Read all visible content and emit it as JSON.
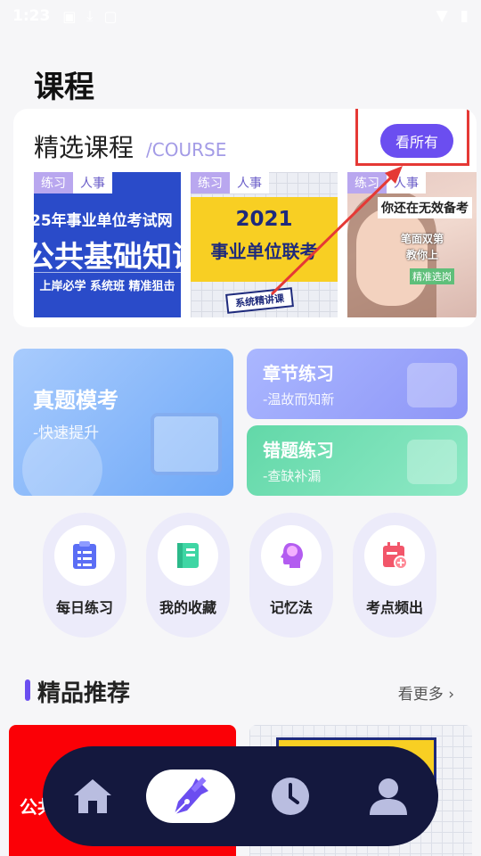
{
  "status_bar": {
    "time": "1:23",
    "icons": [
      "image-icon",
      "download-icon",
      "android-icon",
      "wifi-icon",
      "battery-icon"
    ]
  },
  "page": {
    "title": "课程"
  },
  "courses": {
    "title": "精选课程",
    "subtitle": "/COURSE",
    "see_all": "看所有",
    "items": [
      {
        "tags": [
          "练习",
          "人事"
        ],
        "line1": "25年事业单位考试网",
        "line2": "公共基础知识",
        "line3": "上岸必学 系统班 精准狙击"
      },
      {
        "tags": [
          "练习",
          "人事"
        ],
        "year": "2021",
        "title": "事业单位联考",
        "badge": "系统精讲课"
      },
      {
        "tags": [
          "练习",
          "人事"
        ],
        "cap1": "你还在无效备考",
        "cap2": "笔面双第",
        "cap3": "教你上",
        "cap4": "精准选岗"
      }
    ]
  },
  "tiles": {
    "exam": {
      "title": "真题模考",
      "sub": "-快速提升"
    },
    "chapter": {
      "title": "章节练习",
      "sub": "-温故而知新"
    },
    "wrong": {
      "title": "错题练习",
      "sub": "-查缺补漏"
    }
  },
  "quick_actions": [
    {
      "label": "每日练习",
      "icon": "clipboard-list-icon",
      "color": "#5b6ef5"
    },
    {
      "label": "我的收藏",
      "icon": "bookmark-book-icon",
      "color": "#3fd6a4"
    },
    {
      "label": "记忆法",
      "icon": "brain-head-icon",
      "color": "#b35cf0"
    },
    {
      "label": "考点频出",
      "icon": "calendar-plus-icon",
      "color": "#f2566a"
    }
  ],
  "recommend": {
    "title": "精品推荐",
    "more": "看更多",
    "promo_text": "公共"
  },
  "nav": {
    "items": [
      "home-icon",
      "pen-icon",
      "clock-icon",
      "user-icon"
    ],
    "active_index": 1
  },
  "colors": {
    "accent": "#6b4ef0",
    "highlight": "#e53935",
    "nav_bg": "#14183e"
  }
}
